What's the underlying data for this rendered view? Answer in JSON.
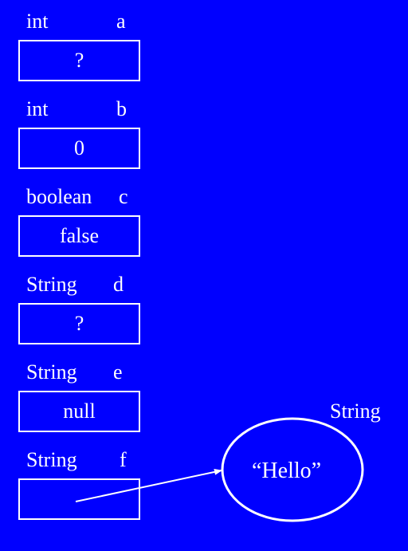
{
  "variables": [
    {
      "type": "int",
      "name": "a",
      "value": "?"
    },
    {
      "type": "int",
      "name": "b",
      "value": "0"
    },
    {
      "type": "boolean",
      "name": "c",
      "value": "false"
    },
    {
      "type": "String",
      "name": "d",
      "value": "?"
    },
    {
      "type": "String",
      "name": "e",
      "value": "null"
    },
    {
      "type": "String",
      "name": "f",
      "value": ""
    }
  ],
  "object": {
    "type_label": "String",
    "value": "“Hello”"
  },
  "colors": {
    "background": "#0000ff",
    "foreground": "#ffffff"
  }
}
